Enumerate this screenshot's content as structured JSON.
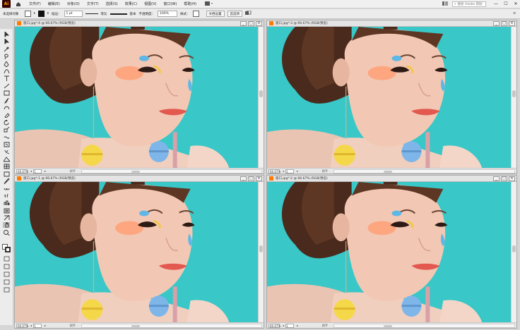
{
  "menubar": {
    "app_logo": "Ai",
    "items": [
      "文件(F)",
      "编辑(E)",
      "对象(O)",
      "文字(T)",
      "选择(S)",
      "效果(C)",
      "视图(V)",
      "窗口(W)",
      "帮助(H)"
    ],
    "search_placeholder": "搜索 Adobe 帮助",
    "min": "—",
    "max": "☐",
    "close": "✕"
  },
  "controlbar": {
    "selection": "未选择对象",
    "stroke_label": "描边：",
    "stroke_value": "1 pt",
    "line_style": "等比",
    "brush": "基本",
    "opacity_label": "不透明度：",
    "opacity_value": "100%",
    "style_label": "样式：",
    "doc_setup": "文档设置",
    "prefs": "首选项"
  },
  "windows": [
    {
      "title": "窗口.jpg*:4 @ 66.67% (RGB/预览)",
      "zoom": "66.67%",
      "page": "1",
      "tool": "抓手"
    },
    {
      "title": "窗口.jpg*:3 @ 66.67% (RGB/预览)",
      "zoom": "66.67%",
      "page": "1",
      "tool": "抓手"
    },
    {
      "title": "窗口.jpg*:1 @ 66.67% (RGB/预览)",
      "zoom": "66.67%",
      "page": "1",
      "tool": "抓手"
    },
    {
      "title": "窗口.jpg*:2 @ 66.67% (RGB/预览)",
      "zoom": "66.67%",
      "page": "1",
      "tool": "抓手"
    }
  ],
  "colors": {
    "background_teal": "#39c7c7",
    "macaron_yellow": "#f4d84a",
    "macaron_blue": "#7eb6ea"
  }
}
